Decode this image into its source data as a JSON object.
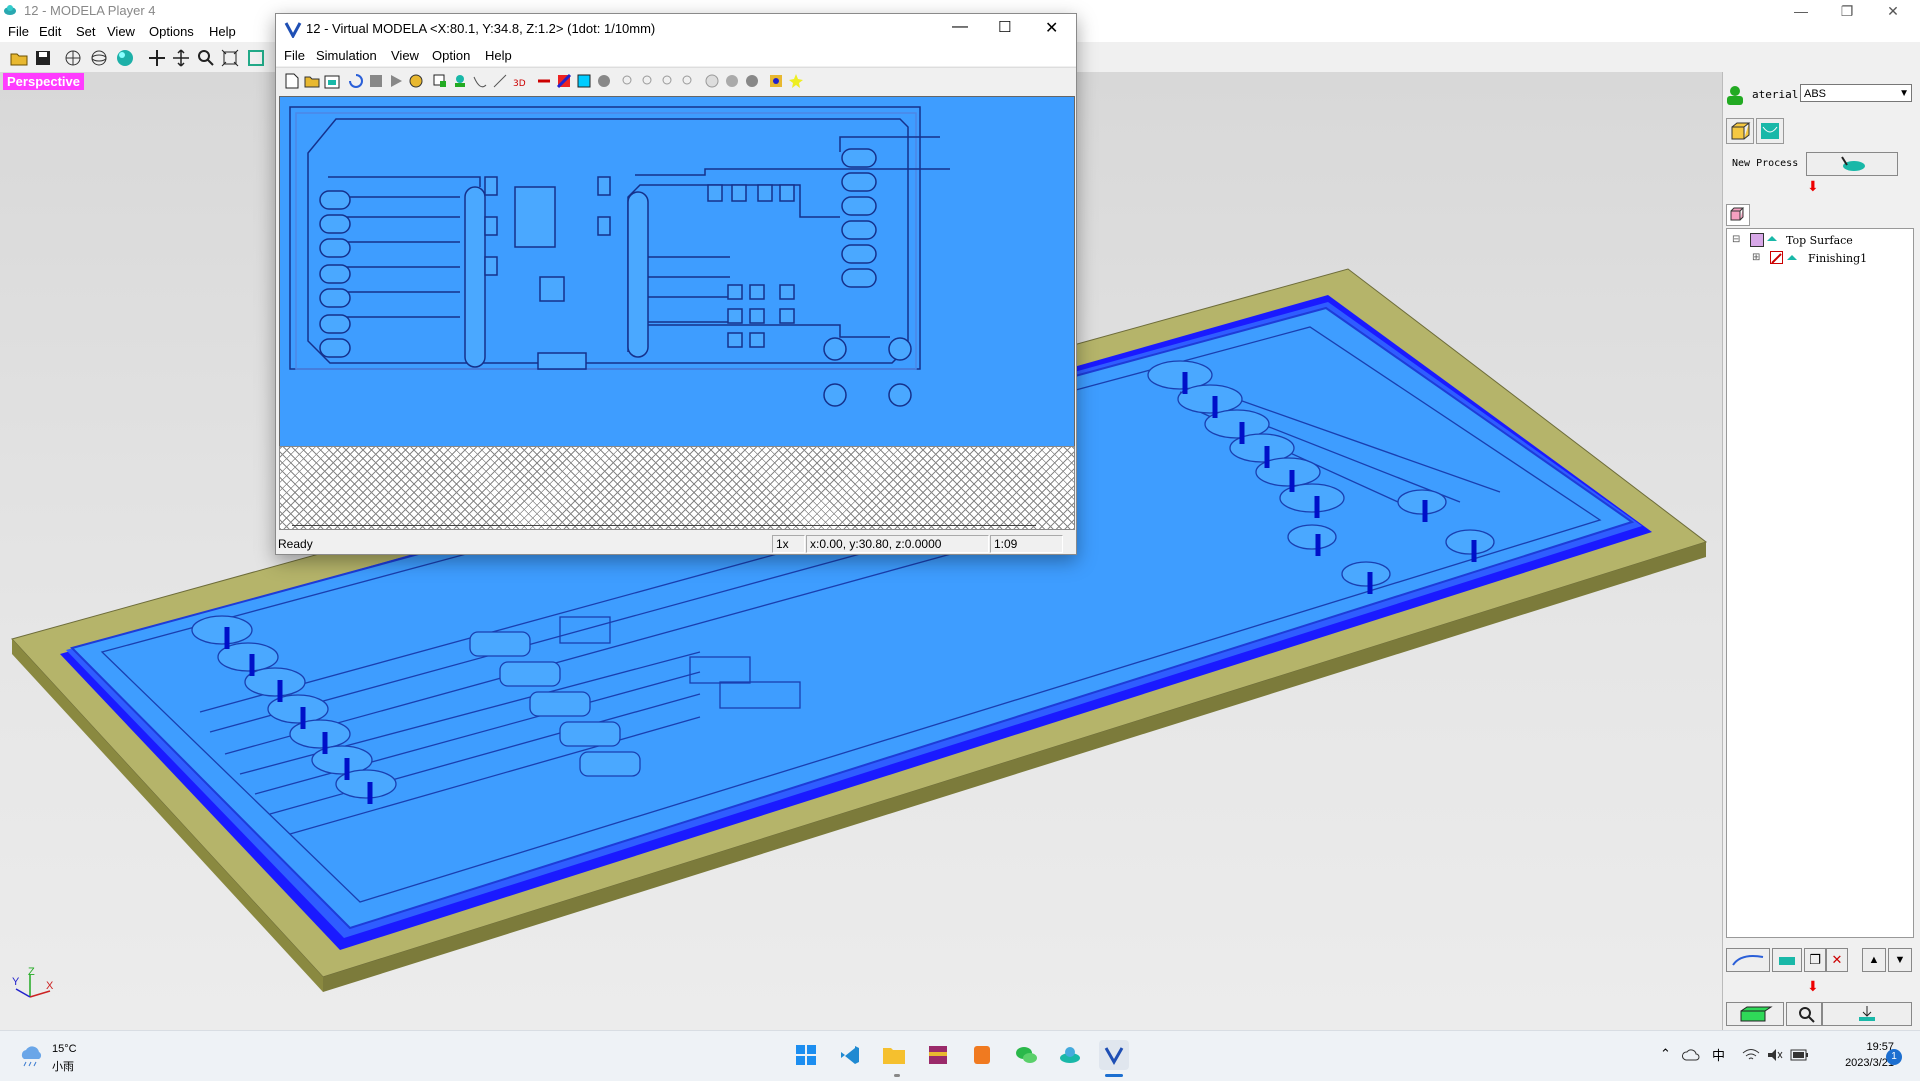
{
  "main_window": {
    "title": "12 - MODELA Player 4",
    "menu": [
      "File",
      "Edit",
      "Set",
      "View",
      "Options",
      "Help"
    ],
    "view_label": "Perspective",
    "axis_labels": {
      "x": "X",
      "y": "Y",
      "z": "Z"
    }
  },
  "right_panel": {
    "material_label": "aterial",
    "material_value": "ABS",
    "new_process_label": "New Process",
    "tree": [
      {
        "label": "Top Surface"
      },
      {
        "label": "Finishing1"
      }
    ]
  },
  "virtual_modela": {
    "title": "12 - Virtual MODELA <X:80.1, Y:34.8, Z:1.2> (1dot: 1/10mm)",
    "menu": [
      "File",
      "Simulation",
      "View",
      "Option",
      "Help"
    ],
    "status": {
      "message": "Ready",
      "zoom": "1x",
      "coords": "x:0.00, y:30.80, z:0.0000",
      "time": "1:09"
    }
  },
  "taskbar": {
    "weather_temp": "15°C",
    "weather_desc": "小雨",
    "ime": "中",
    "time": "19:57",
    "date": "2023/3/21",
    "notification_count": "1"
  },
  "colors": {
    "pcb_blue": "#3e9dff",
    "stock_olive": "#b5b46a",
    "perspective_bg": "#ff3cff"
  }
}
